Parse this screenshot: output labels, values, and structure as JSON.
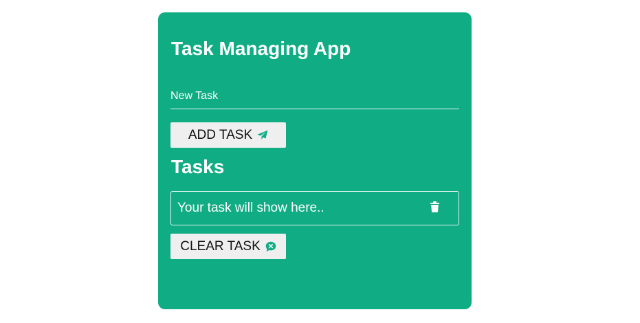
{
  "app": {
    "title": "Task Managing App"
  },
  "new_task": {
    "placeholder": "New Task",
    "value": ""
  },
  "add_button": {
    "label": "ADD TASK",
    "icon": "paper-plane-icon"
  },
  "tasks_section": {
    "heading": "Tasks",
    "items": [
      {
        "text": "Your task will show here..",
        "delete_icon": "trash-icon"
      }
    ]
  },
  "clear_button": {
    "label": "CLEAR TASK",
    "icon": "comment-x-icon"
  },
  "colors": {
    "card_background": "#10ac84",
    "button_background": "#efefef",
    "text_light": "#ffffff",
    "text_dark": "#111111"
  }
}
